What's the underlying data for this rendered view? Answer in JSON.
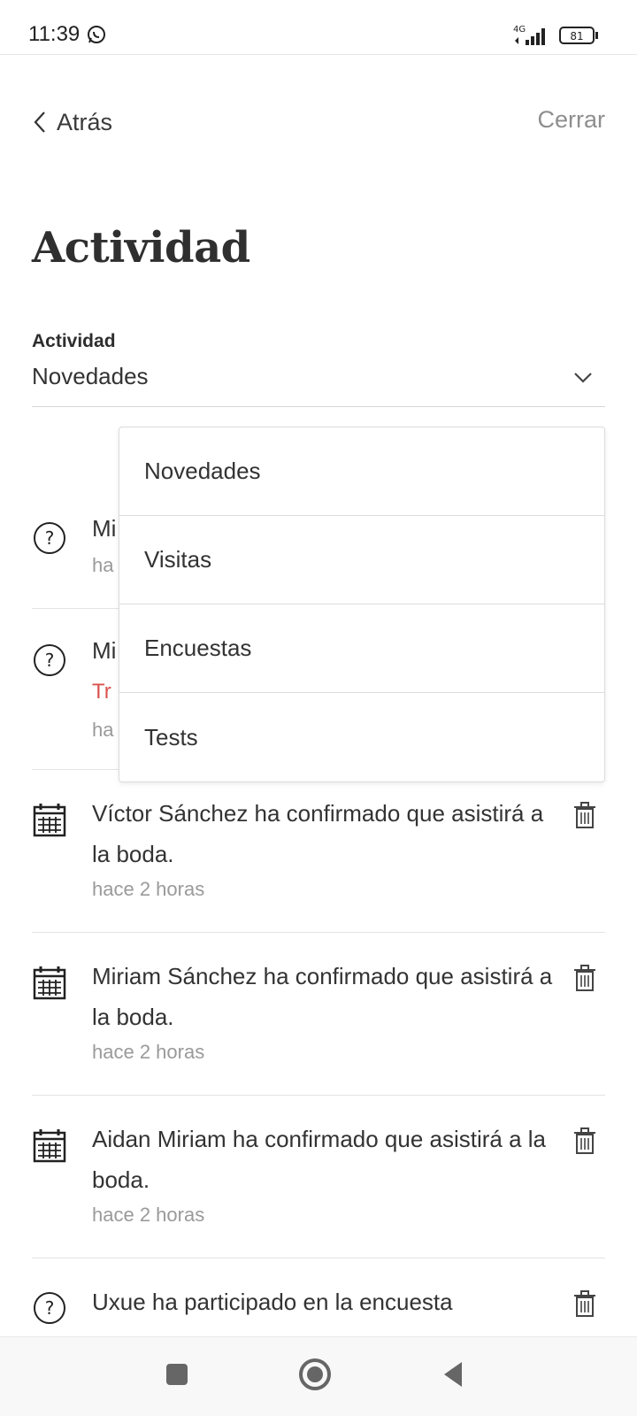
{
  "status": {
    "time": "11:39",
    "network": "4G",
    "battery": "81"
  },
  "nav": {
    "back_label": "Atrás",
    "close_label": "Cerrar"
  },
  "page": {
    "title": "Actividad"
  },
  "filter": {
    "label": "Actividad",
    "value": "Novedades"
  },
  "dropdown": {
    "options": [
      "Novedades",
      "Visitas",
      "Encuestas",
      "Tests"
    ]
  },
  "activities": [
    {
      "icon": "question-circle-icon",
      "text": "Mi",
      "time": "ha"
    },
    {
      "icon": "question-circle-icon",
      "text": "Mi",
      "link": "Tr",
      "time": "ha"
    },
    {
      "icon": "calendar-icon",
      "text": "Víctor Sánchez ha confirmado que asistirá a la boda.",
      "time": "hace 2 horas"
    },
    {
      "icon": "calendar-icon",
      "text": "Miriam Sánchez ha confirmado que asistirá a la boda.",
      "time": "hace 2 horas"
    },
    {
      "icon": "calendar-icon",
      "text": "Aidan Miriam ha confirmado que asistirá a la boda.",
      "time": "hace 2 horas"
    },
    {
      "icon": "question-circle-icon",
      "text": "Uxue ha participado en la encuesta",
      "time": ""
    }
  ],
  "colors": {
    "accent_link": "#d9534f",
    "muted": "#9a9a9a",
    "text": "#333333"
  }
}
